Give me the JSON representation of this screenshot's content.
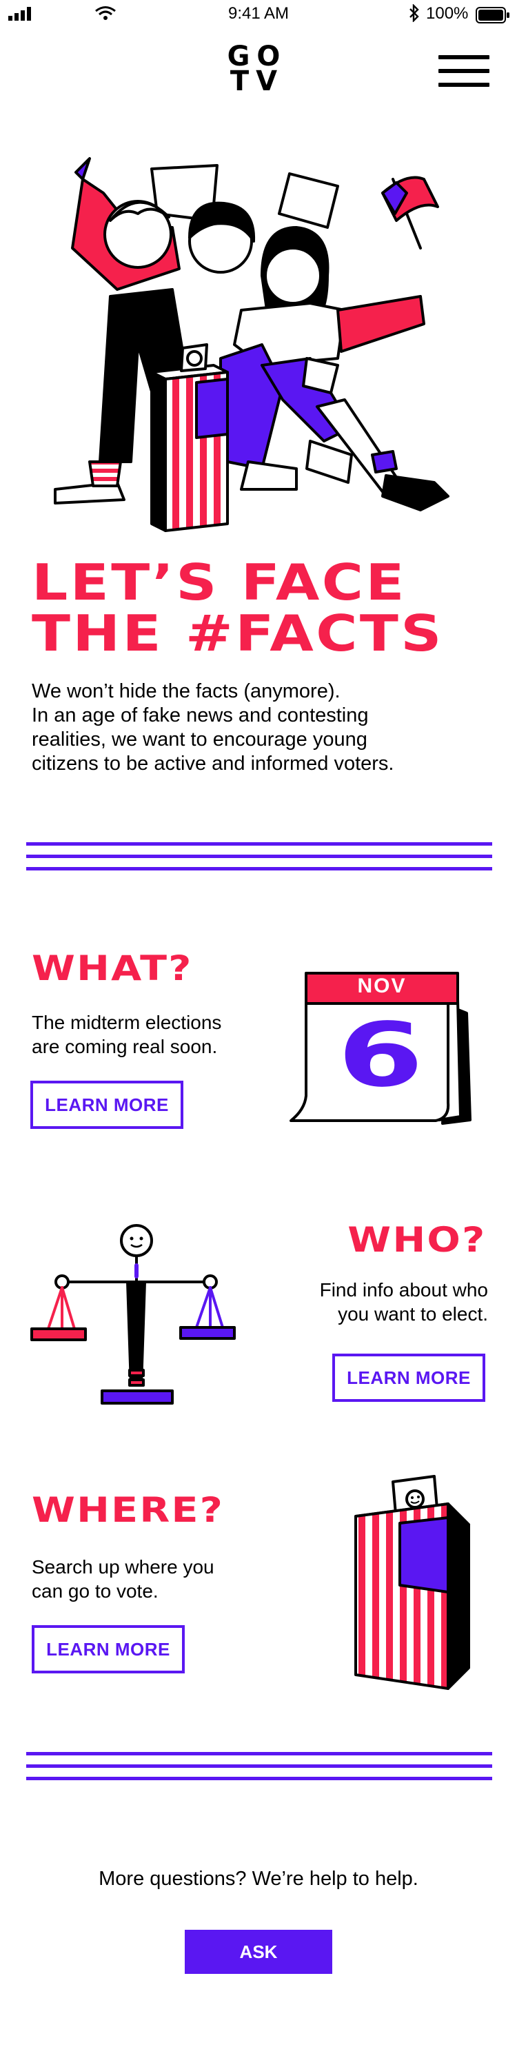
{
  "status_bar": {
    "time": "9:41 AM",
    "battery": "100%"
  },
  "header": {
    "logo_line1": "GO",
    "logo_line2": "TV"
  },
  "hero": {
    "title_line1": "LET’S FACE",
    "title_line2": "THE #FACTS",
    "intro_lines": [
      "We won’t hide the facts (anymore).",
      "In an age of fake news and contesting",
      "realities, we want to encourage young",
      "citizens to be active and informed voters."
    ]
  },
  "sections": [
    {
      "title": "WHAT?",
      "text_lines": [
        "The midterm elections",
        "are coming real soon."
      ],
      "button": "LEARN MORE",
      "calendar": {
        "month": "NOV",
        "day": "6"
      }
    },
    {
      "title": "WHO?",
      "text_lines": [
        "Find info about who",
        "you want to elect."
      ],
      "button": "LEARN MORE"
    },
    {
      "title": "WHERE?",
      "text_lines": [
        "Search up where you",
        "can go to vote."
      ],
      "button": "LEARN MORE"
    }
  ],
  "footer": {
    "question": "More questions? We’re help to help.",
    "ask": "ASK"
  },
  "colors": {
    "red": "#f5214c",
    "purple": "#5a17f2",
    "black": "#000000"
  }
}
